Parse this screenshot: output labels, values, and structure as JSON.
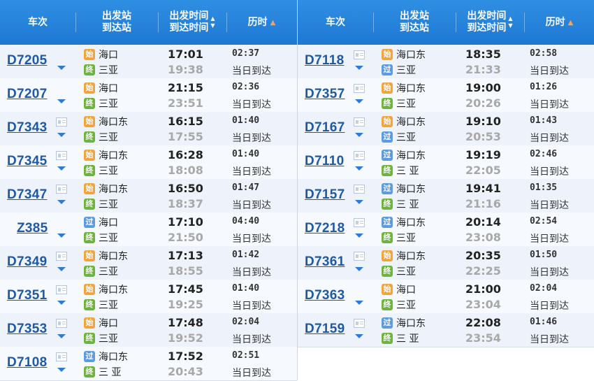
{
  "header": {
    "train_no": "车次",
    "from_station": "出发站",
    "to_station": "到达站",
    "dep_time": "出发时间",
    "arr_time": "到达时间",
    "duration": "历时"
  },
  "glyphs": {
    "sort_up": "▲",
    "sort_down": "▼",
    "sort_orange": "▲"
  },
  "tags": {
    "start": "始",
    "pass": "过",
    "end": "终"
  },
  "left_trains": [
    {
      "no": "D7205",
      "from": "海口",
      "from_tag": "始",
      "to": "三亚",
      "to_tag": "终",
      "dep": "17:01",
      "arr": "19:38",
      "dur": "02:37",
      "note": "当日到达",
      "card": false
    },
    {
      "no": "D7207",
      "from": "海口",
      "from_tag": "始",
      "to": "三亚",
      "to_tag": "终",
      "dep": "21:15",
      "arr": "23:51",
      "dur": "02:36",
      "note": "当日到达",
      "card": false
    },
    {
      "no": "D7343",
      "from": "海口东",
      "from_tag": "始",
      "to": "三亚",
      "to_tag": "终",
      "dep": "16:15",
      "arr": "17:55",
      "dur": "01:40",
      "note": "当日到达",
      "card": true
    },
    {
      "no": "D7345",
      "from": "海口东",
      "from_tag": "始",
      "to": "三亚",
      "to_tag": "终",
      "dep": "16:28",
      "arr": "18:08",
      "dur": "01:40",
      "note": "当日到达",
      "card": true
    },
    {
      "no": "D7347",
      "from": "海口东",
      "from_tag": "始",
      "to": "三亚",
      "to_tag": "终",
      "dep": "16:50",
      "arr": "18:37",
      "dur": "01:47",
      "note": "当日到达",
      "card": true
    },
    {
      "no": "Z385",
      "from": "海口",
      "from_tag": "过",
      "to": "三亚",
      "to_tag": "终",
      "dep": "17:10",
      "arr": "21:50",
      "dur": "04:40",
      "note": "当日到达",
      "card": false
    },
    {
      "no": "D7349",
      "from": "海口东",
      "from_tag": "始",
      "to": "三亚",
      "to_tag": "终",
      "dep": "17:13",
      "arr": "18:55",
      "dur": "01:42",
      "note": "当日到达",
      "card": true
    },
    {
      "no": "D7351",
      "from": "海口东",
      "from_tag": "始",
      "to": "三亚",
      "to_tag": "终",
      "dep": "17:45",
      "arr": "19:25",
      "dur": "01:40",
      "note": "当日到达",
      "card": true
    },
    {
      "no": "D7353",
      "from": "海口",
      "from_tag": "始",
      "to": "三亚",
      "to_tag": "终",
      "dep": "17:48",
      "arr": "19:52",
      "dur": "02:04",
      "note": "当日到达",
      "card": true
    },
    {
      "no": "D7108",
      "from": "海口东",
      "from_tag": "过",
      "to": "三 亚",
      "to_tag": "终",
      "dep": "17:52",
      "arr": "20:43",
      "dur": "02:51",
      "note": "当日到达",
      "card": true
    }
  ],
  "right_trains": [
    {
      "no": "D7118",
      "from": "海口东",
      "from_tag": "始",
      "to": "三亚",
      "to_tag": "过",
      "dep": "18:35",
      "arr": "21:33",
      "dur": "02:58",
      "note": "当日到达",
      "card": true
    },
    {
      "no": "D7357",
      "from": "海口东",
      "from_tag": "始",
      "to": "三亚",
      "to_tag": "终",
      "dep": "19:00",
      "arr": "20:26",
      "dur": "01:26",
      "note": "当日到达",
      "card": true
    },
    {
      "no": "D7167",
      "from": "海口东",
      "from_tag": "始",
      "to": "三亚",
      "to_tag": "过",
      "dep": "19:10",
      "arr": "20:53",
      "dur": "01:43",
      "note": "当日到达",
      "card": true
    },
    {
      "no": "D7110",
      "from": "海口东",
      "from_tag": "过",
      "to": "三 亚",
      "to_tag": "终",
      "dep": "19:19",
      "arr": "22:05",
      "dur": "02:46",
      "note": "当日到达",
      "card": true
    },
    {
      "no": "D7157",
      "from": "海口东",
      "from_tag": "过",
      "to": "三 亚",
      "to_tag": "终",
      "dep": "19:41",
      "arr": "21:16",
      "dur": "01:35",
      "note": "当日到达",
      "card": true
    },
    {
      "no": "D7218",
      "from": "海口东",
      "from_tag": "过",
      "to": "三亚",
      "to_tag": "终",
      "dep": "20:14",
      "arr": "23:08",
      "dur": "02:54",
      "note": "当日到达",
      "card": true
    },
    {
      "no": "D7361",
      "from": "海口东",
      "from_tag": "始",
      "to": "三亚",
      "to_tag": "终",
      "dep": "20:35",
      "arr": "22:25",
      "dur": "01:50",
      "note": "当日到达",
      "card": true
    },
    {
      "no": "D7363",
      "from": "海口",
      "from_tag": "始",
      "to": "三亚",
      "to_tag": "终",
      "dep": "21:00",
      "arr": "23:04",
      "dur": "02:04",
      "note": "当日到达",
      "card": false
    },
    {
      "no": "D7159",
      "from": "海口东",
      "from_tag": "过",
      "to": "三 亚",
      "to_tag": "终",
      "dep": "22:08",
      "arr": "23:54",
      "dur": "01:46",
      "note": "当日到达",
      "card": true
    }
  ]
}
